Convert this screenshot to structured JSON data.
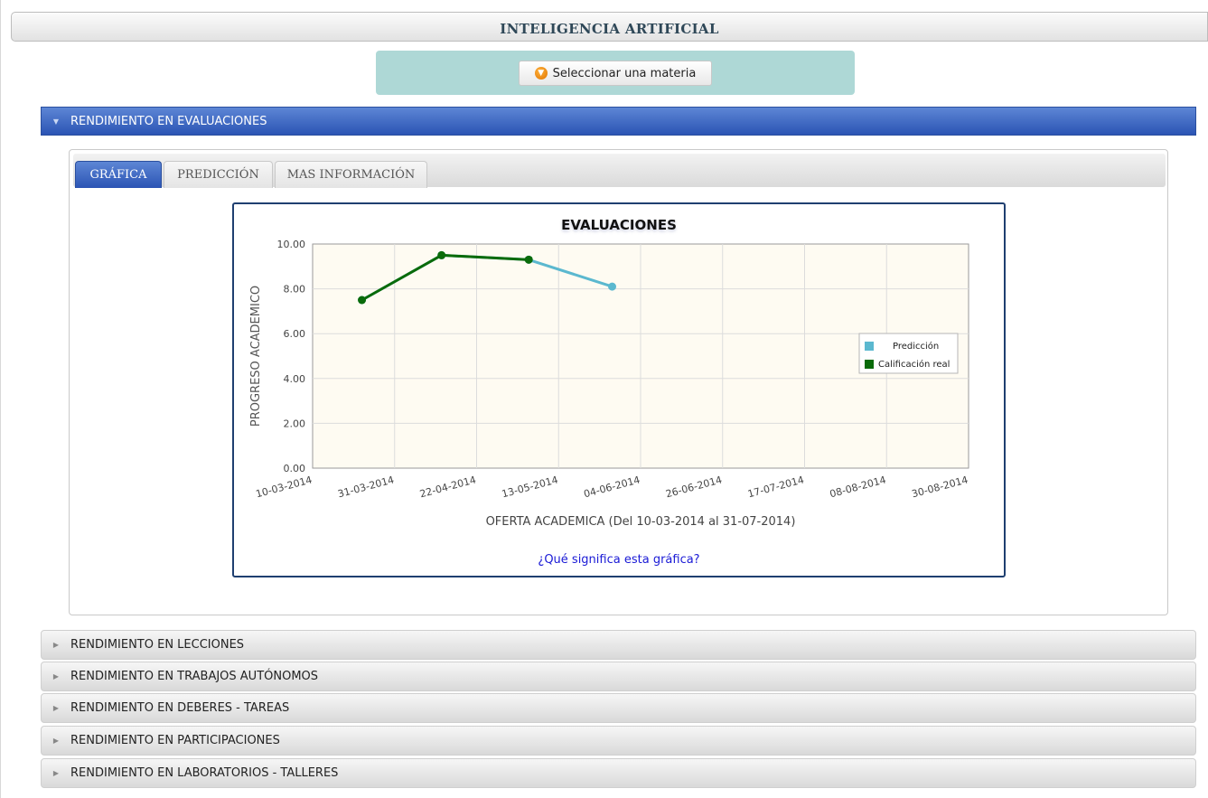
{
  "page": {
    "title": "INTELIGENCIA ARTIFICIAL"
  },
  "subject_selector": {
    "button_label": "Seleccionar una materia",
    "icon": "orange-circle-down-arrow-icon"
  },
  "sections": {
    "active": {
      "label": "RENDIMIENTO EN EVALUACIONES"
    },
    "collapsed": [
      {
        "label": "RENDIMIENTO EN LECCIONES"
      },
      {
        "label": "RENDIMIENTO EN TRABAJOS AUTÓNOMOS"
      },
      {
        "label": "RENDIMIENTO EN DEBERES - TAREAS"
      },
      {
        "label": "RENDIMIENTO EN PARTICIPACIONES"
      },
      {
        "label": "RENDIMIENTO EN LABORATORIOS - TALLERES"
      }
    ]
  },
  "tabs": [
    {
      "label": "GRÁFICA",
      "active": true
    },
    {
      "label": "PREDICCIÓN",
      "active": false
    },
    {
      "label": "MAS INFORMACIÓN",
      "active": false
    }
  ],
  "help_link": "¿Qué significa esta gráfica?",
  "colors": {
    "header_blue": "#2b54b4",
    "panel_teal": "#aed8d6",
    "prediction": "#5bb8cf",
    "real": "#0a6b0a",
    "plot_bg": "#fefbf2"
  },
  "chart_data": {
    "type": "line",
    "title": "EVALUACIONES",
    "xlabel": "OFERTA ACADEMICA (Del 10-03-2014 al 31-07-2014)",
    "ylabel": "PROGRESO ACADEMICO",
    "x_tick_labels": [
      "10-03-2014",
      "31-03-2014",
      "22-04-2014",
      "13-05-2014",
      "04-06-2014",
      "26-06-2014",
      "17-07-2014",
      "08-08-2014",
      "30-08-2014"
    ],
    "y_tick_labels": [
      "0.00",
      "2.00",
      "4.00",
      "6.00",
      "8.00",
      "10.00"
    ],
    "xlim": [
      "2014-03-10",
      "2014-08-30"
    ],
    "ylim": [
      0,
      10
    ],
    "grid": true,
    "legend_position": "right",
    "series": [
      {
        "name": "Predicción",
        "color": "#5bb8cf",
        "points": [
          [
            "2014-03-23",
            7.5
          ],
          [
            "2014-04-13",
            9.5
          ],
          [
            "2014-05-06",
            9.3
          ],
          [
            "2014-05-28",
            8.1
          ]
        ]
      },
      {
        "name": "Calificación real",
        "color": "#0a6b0a",
        "points": [
          [
            "2014-03-23",
            7.5
          ],
          [
            "2014-04-13",
            9.5
          ],
          [
            "2014-05-06",
            9.3
          ]
        ]
      }
    ]
  }
}
